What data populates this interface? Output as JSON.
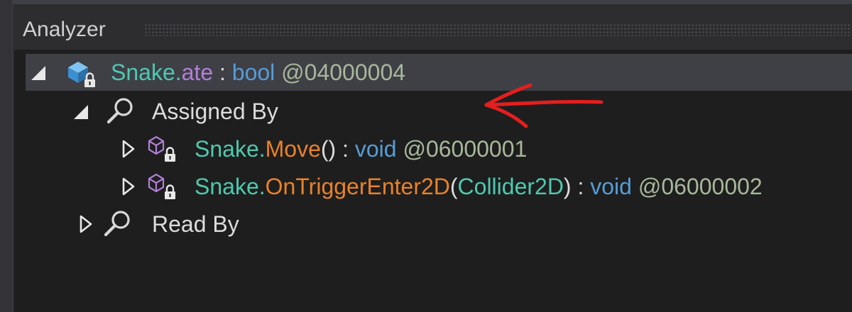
{
  "panel": {
    "title": "Analyzer"
  },
  "tree": {
    "root": {
      "type_name": "Snake",
      "dot": ".",
      "member_name": "ate",
      "separator": " : ",
      "return_type": "bool",
      "token": " @04000004"
    },
    "assigned_by": {
      "label": "Assigned By",
      "items": [
        {
          "type_name": "Snake",
          "dot": ".",
          "method_name": "Move",
          "params_open": "()",
          "param_type": "",
          "params_close": "",
          "separator": " : ",
          "return_type": "void",
          "token": " @06000001"
        },
        {
          "type_name": "Snake",
          "dot": ".",
          "method_name": "OnTriggerEnter2D",
          "params_open": "(",
          "param_type": "Collider2D",
          "params_close": ")",
          "separator": " : ",
          "return_type": "void",
          "token": " @06000002"
        }
      ]
    },
    "read_by": {
      "label": "Read By"
    }
  },
  "colors": {
    "type": "#4ec9b0",
    "field": "#b180d7",
    "method": "#e8822a",
    "keyword": "#569cd6",
    "annotation_arrow": "#e51e1e"
  },
  "icons": {
    "root": "field-lock-icon",
    "assigned_by": "search-icon",
    "method_items": "method-lock-icon",
    "read_by": "search-icon",
    "expanded": "triangle-expanded-icon",
    "collapsed": "triangle-collapsed-icon"
  }
}
